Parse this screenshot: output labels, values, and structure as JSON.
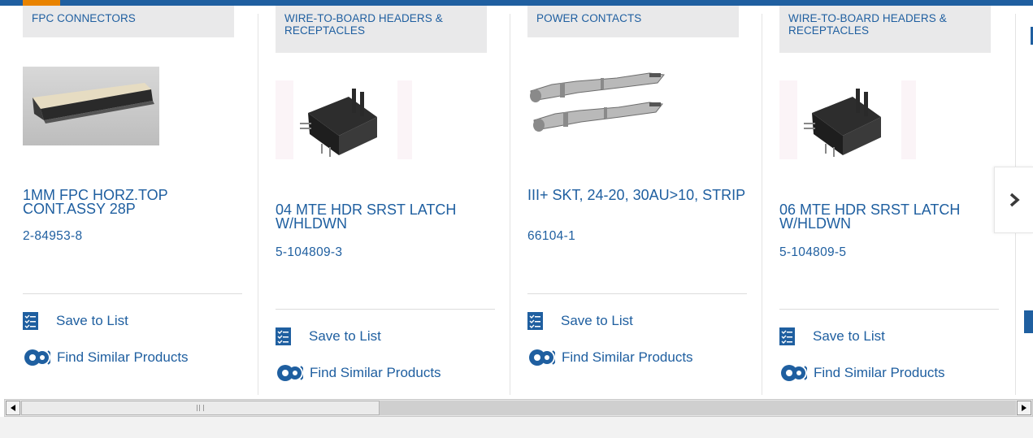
{
  "products": [
    {
      "category": "FPC CONNECTORS",
      "title": "1MM FPC HORZ.TOP CONT.ASSY 28P",
      "part_number": "2-84953-8",
      "image": "fpc-connector"
    },
    {
      "category": "WIRE-TO-BOARD HEADERS & RECEPTACLES",
      "title": "04 MTE HDR SRST LATCH W/HLDWN",
      "part_number": "5-104809-3",
      "image": "header"
    },
    {
      "category": "POWER CONTACTS",
      "title": "III+ SKT, 24-20, 30AU>10, STRIP",
      "part_number": "66104-1",
      "image": "power-contact"
    },
    {
      "category": "WIRE-TO-BOARD HEADERS & RECEPTACLES",
      "title": "06 MTE HDR SRST LATCH W/HLDWN",
      "part_number": "5-104809-5",
      "image": "header"
    }
  ],
  "actions": {
    "save_label": "Save to List",
    "similar_label": "Find Similar Products"
  },
  "icons": {
    "save": "checklist-icon",
    "similar": "gears-icon",
    "next": "chevron-right-icon"
  },
  "scrollbar": {
    "position": 0.36
  },
  "colors": {
    "brand_blue": "#1f5fa0",
    "accent_orange": "#e98300",
    "category_bg": "#e9e9ea"
  }
}
